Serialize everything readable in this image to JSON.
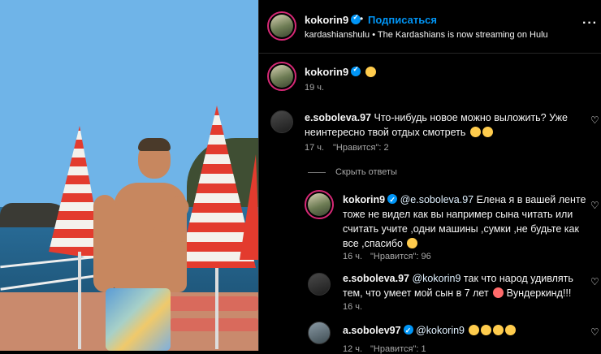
{
  "post": {
    "author": "kokorin9",
    "follow_label": "Подписаться",
    "sponsored_source": "kardashianshulu",
    "sponsored_text": "The Kardashians is now streaming on Hulu",
    "caption_time": "19 ч."
  },
  "comments": [
    {
      "username": "e.soboleva.97",
      "text": "Что-нибудь новое можно выложить? Уже неинтересно твой отдых смотреть",
      "time": "17 ч.",
      "likes": "\"Нравится\": 2"
    }
  ],
  "replies_toggle": "Скрыть ответы",
  "replies": [
    {
      "username": "kokorin9",
      "mention": "@e.soboleva.97",
      "text": "Елена я в вашей ленте тоже не видел как вы например сына читать или считать учите ,одни машины ,сумки ,не будьте как все ,спасибо",
      "time": "16 ч.",
      "likes": "\"Нравится\": 96"
    },
    {
      "username": "e.soboleva.97",
      "mention": "@kokorin9",
      "text": "так что народ удивлять тем, что умеет мой сын в 7 лет",
      "text_end": "Вундеркинд!!!",
      "time": "16 ч."
    },
    {
      "username": "a.sobolev97",
      "mention": "@kokorin9",
      "time": "12 ч.",
      "likes": "\"Нравится\": 1"
    }
  ],
  "icons": {
    "verified": "verified-badge-icon",
    "heart": "heart-icon",
    "more": "more-icon"
  },
  "colors": {
    "accent": "#0095f6",
    "background": "#000000",
    "muted": "#a8a8a8"
  }
}
